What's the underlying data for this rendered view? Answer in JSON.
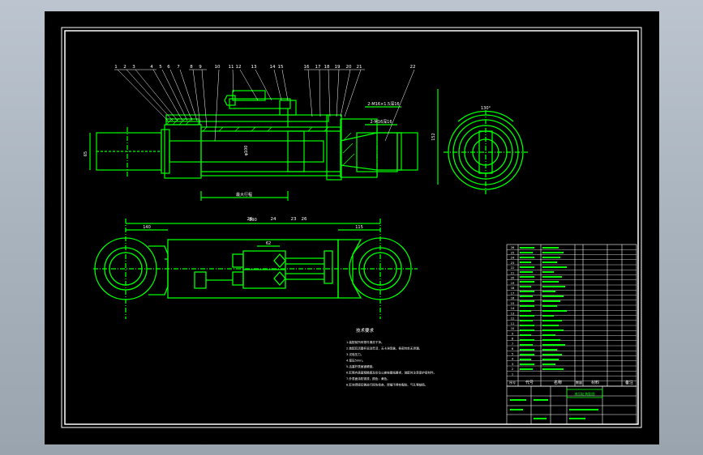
{
  "colors": {
    "line": "#00ff00",
    "text": "#ffffff",
    "background": "#000000",
    "frame": "#ffffff",
    "highlight": "#ffff66"
  },
  "balloons": [
    "1",
    "2",
    "3",
    "4",
    "5",
    "6",
    "7",
    "8",
    "9",
    "10",
    "11",
    "12",
    "13",
    "14",
    "15",
    "16",
    "17",
    "18",
    "19",
    "20",
    "21",
    "22"
  ],
  "balloons_plan": [
    "25",
    "24",
    "23",
    "26"
  ],
  "dims": {
    "port_top": "2-M16×1.5深16",
    "port_mid": "2-M16深16",
    "stroke": "最大行程",
    "plan_total": "890",
    "plan_left": "140",
    "plan_right": "115",
    "plan_mid": "62",
    "left_height": "65",
    "right_height": "152",
    "bore": "φ100",
    "angle": "130°"
  },
  "notes": {
    "title": "技术要求",
    "lines": [
      "1.装配前所有零件清洗干净。",
      "2.装配后活塞杆运动灵活，无卡滞现象，各密封处无泄漏。",
      "3.试验压力。",
      "4.保压5min。",
      "5.活塞杆表面镀硬铬。",
      "6.缸筒内表面粗糙度及形位公差按图纸要求，装配时注意保护密封件。",
      "7.外表面涂防锈漆，颜色：黄色。",
      "8.缸体焊接后需进行探伤检查，焊缝不得有裂纹、气孔等缺陷。"
    ]
  },
  "bom": {
    "header": {
      "seq": "序号",
      "code": "代号",
      "name": "名称",
      "qty": "数量",
      "material": "材料",
      "note": "备注"
    },
    "rows": [
      "26",
      "25",
      "24",
      "23",
      "22",
      "21",
      "20",
      "19",
      "18",
      "17",
      "16",
      "15",
      "14",
      "13",
      "12",
      "11",
      "10",
      "9",
      "8",
      "7",
      "6",
      "5",
      "4",
      "3",
      "2",
      "1"
    ]
  },
  "title_block": {
    "title": "液压缸装配图"
  }
}
